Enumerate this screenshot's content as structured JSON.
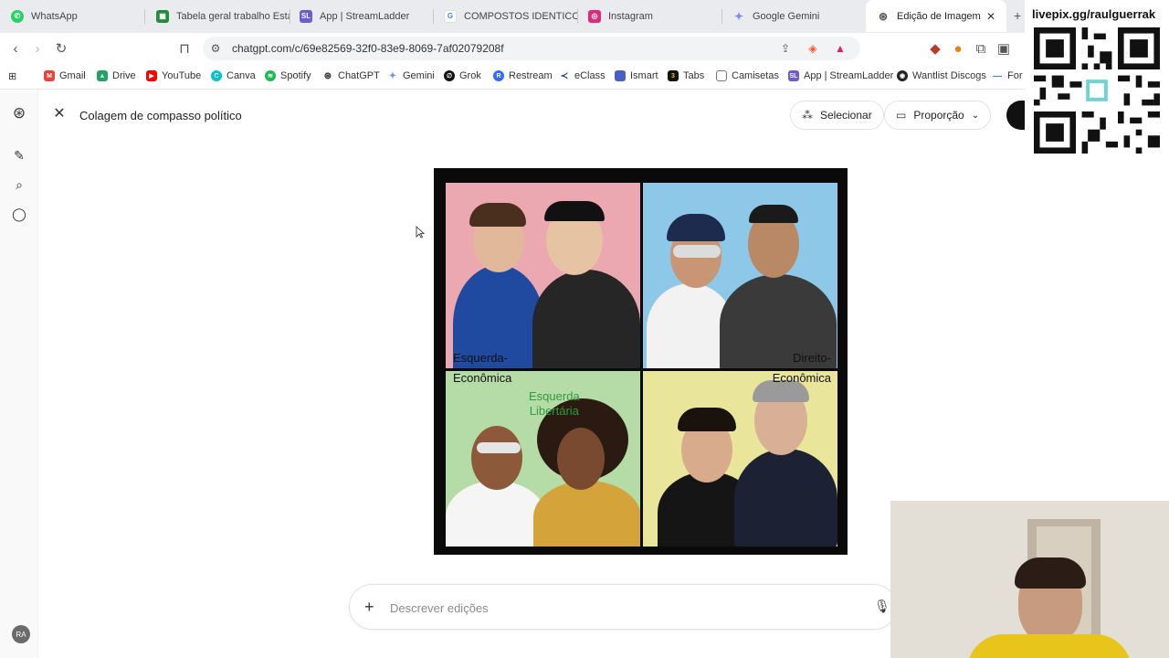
{
  "browser": {
    "tabs": [
      {
        "label": "WhatsApp",
        "color": "#25d366"
      },
      {
        "label": "Tabela geral trabalho Esta",
        "color": "#1e8e3e"
      },
      {
        "label": "App | StreamLadder",
        "color": "#6e5ad6"
      },
      {
        "label": "COMPOSTOS IDENTICOS",
        "color": "#4285f4"
      },
      {
        "label": "Instagram",
        "color": "#dd2a7b"
      },
      {
        "label": "Google Gemini",
        "color": "#7b8cf5"
      },
      {
        "label": "Edição de Imagem",
        "color": "#555555"
      }
    ],
    "url": "chatgpt.com/c/69e82569-32f0-83e9-8069-7af02079208f",
    "bookmarks": [
      {
        "label": "Gmail",
        "color": "#ea4335"
      },
      {
        "label": "Drive",
        "color": "#1fa463"
      },
      {
        "label": "YouTube",
        "color": "#ff0000"
      },
      {
        "label": "Canva",
        "color": "#00c4cc"
      },
      {
        "label": "Spotify",
        "color": "#1db954"
      },
      {
        "label": "ChatGPT",
        "color": "#333333"
      },
      {
        "label": "Gemini",
        "color": "#7b8cf5"
      },
      {
        "label": "Grok",
        "color": "#111111"
      },
      {
        "label": "Restream",
        "color": "#2f6bff"
      },
      {
        "label": "eClass",
        "color": "#1f3b8c"
      },
      {
        "label": "Ismart",
        "color": "#4a5ec9"
      },
      {
        "label": "Tabs",
        "color": "#111111"
      },
      {
        "label": "Camisetas",
        "color": "#777777"
      },
      {
        "label": "App | StreamLadder",
        "color": "#6e5ad6"
      },
      {
        "label": "Wantlist Discogs",
        "color": "#222222"
      },
      {
        "label": "For",
        "color": "#1fa463"
      }
    ]
  },
  "app": {
    "page_title": "Colagem de compasso político",
    "select_label": "Selecionar",
    "ratio_label": "Proporção",
    "avatar_initials": "RA"
  },
  "collage": {
    "left_label_1": "Esquerda-",
    "left_label_2": "Econômica",
    "right_label_1": "Direito-",
    "right_label_2": "Econômica",
    "green_label_1": "Esquerda",
    "green_label_2": "Libertária",
    "quadrant_colors": [
      "#eba8b0",
      "#8ec8e8",
      "#b5dba7",
      "#e9e59a"
    ]
  },
  "prompt": {
    "placeholder": "Descrever edições"
  },
  "overlay": {
    "qr_caption": "livepix.gg/raulguerrak"
  }
}
